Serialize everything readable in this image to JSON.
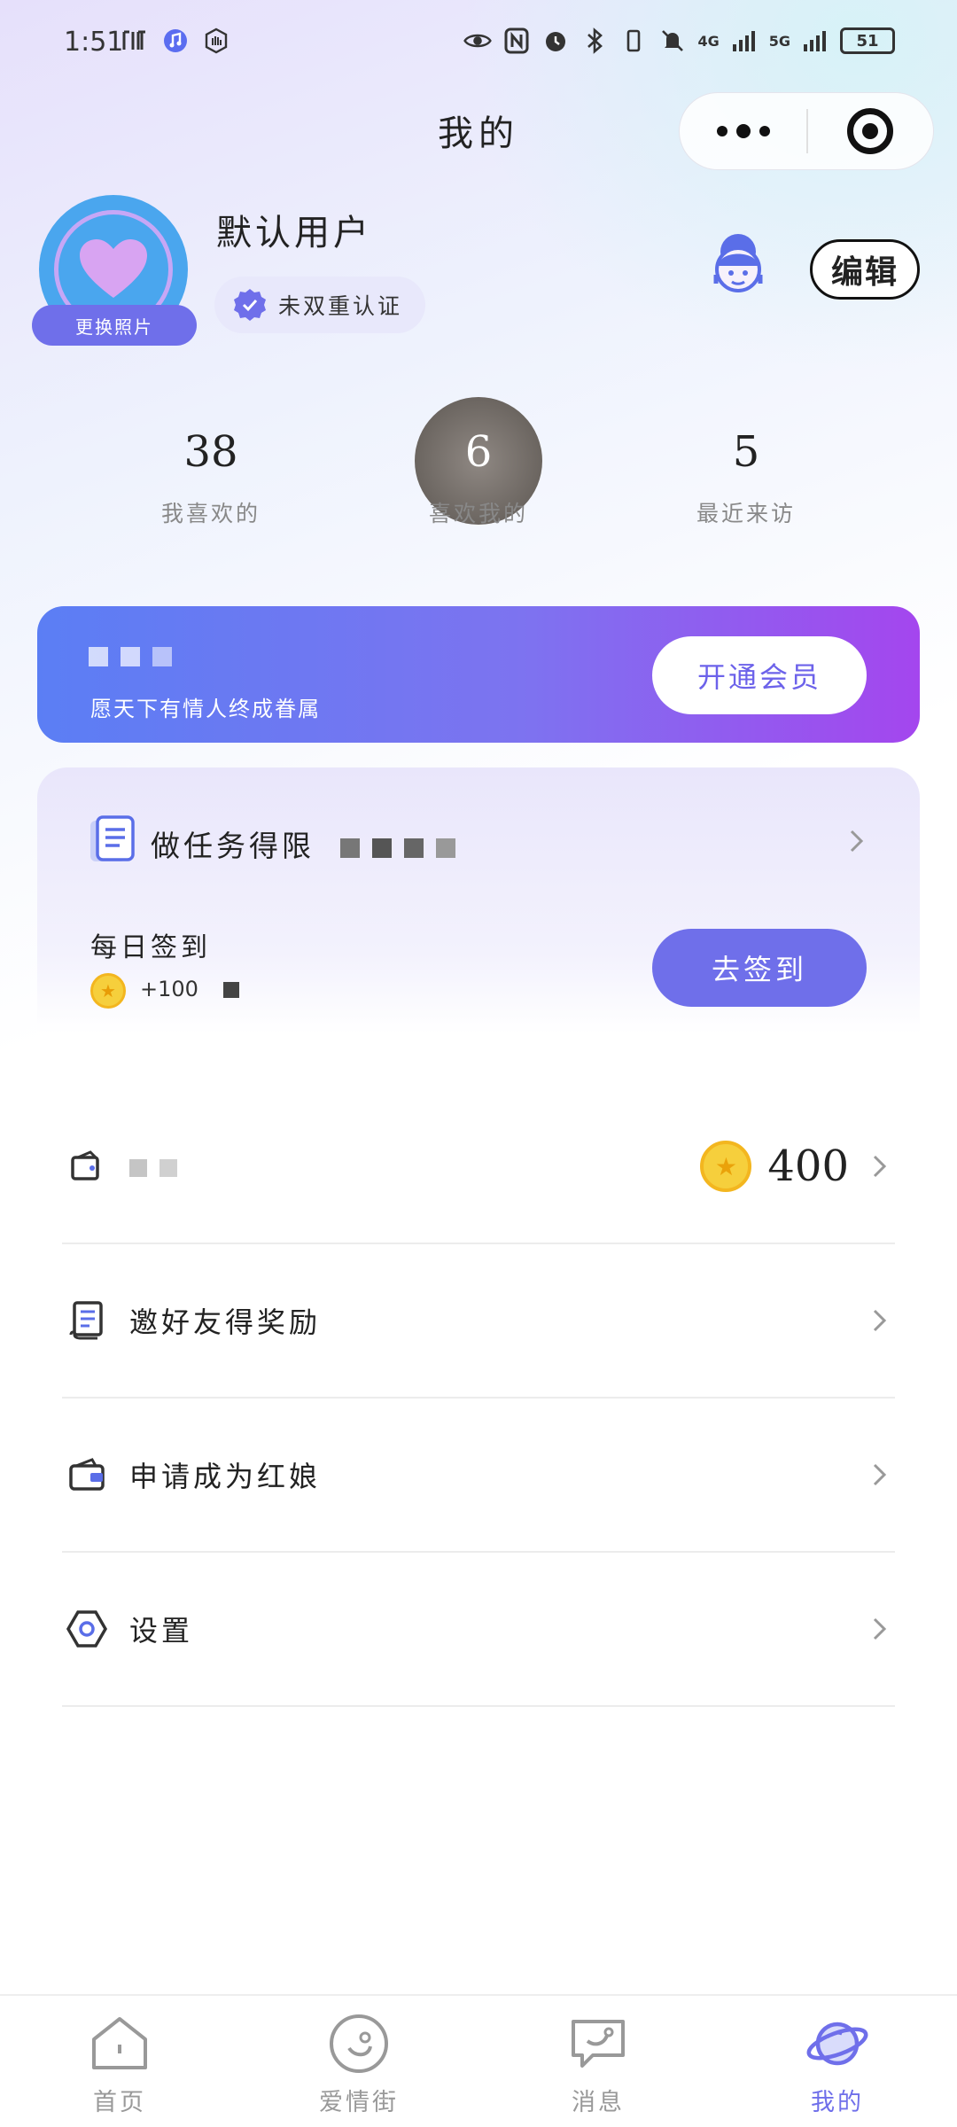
{
  "status_bar": {
    "time": "1:51",
    "network_4g": "4G",
    "network_5g": "5G",
    "battery": "51"
  },
  "header": {
    "title": "我的",
    "more_icon": "more-dots-icon",
    "close_icon": "target-circle-icon"
  },
  "profile": {
    "username": "默认用户",
    "change_photo": "更换照片",
    "verify_status": "未双重认证",
    "edit_label": "编辑",
    "service_icon": "customer-service-icon"
  },
  "stats": [
    {
      "value": "38",
      "label": "我喜欢的"
    },
    {
      "value": "6",
      "label": "喜欢我的"
    },
    {
      "value": "5",
      "label": "最近来访"
    }
  ],
  "vip": {
    "subtitle": "愿天下有情人终成眷属",
    "button": "开通会员"
  },
  "tasks": {
    "title": "做任务得限",
    "checkin_label": "每日签到",
    "checkin_reward": "+100",
    "checkin_button": "去签到"
  },
  "menu": {
    "wallet_value": "400",
    "items": [
      {
        "label": "邀好友得奖励",
        "icon": "receipt-icon"
      },
      {
        "label": "申请成为红娘",
        "icon": "wallet-icon"
      },
      {
        "label": "设置",
        "icon": "hexagon-settings-icon"
      }
    ]
  },
  "tabs": [
    {
      "label": "首页",
      "icon": "home-icon",
      "active": false
    },
    {
      "label": "爱情街",
      "icon": "love-street-icon",
      "active": false
    },
    {
      "label": "消息",
      "icon": "message-icon",
      "active": false
    },
    {
      "label": "我的",
      "icon": "planet-icon",
      "active": true
    }
  ],
  "colors": {
    "accent": "#6f6fea",
    "vip_gradient_start": "#5b7ef4",
    "vip_gradient_end": "#a446ee",
    "coin": "#f6cf3c"
  }
}
